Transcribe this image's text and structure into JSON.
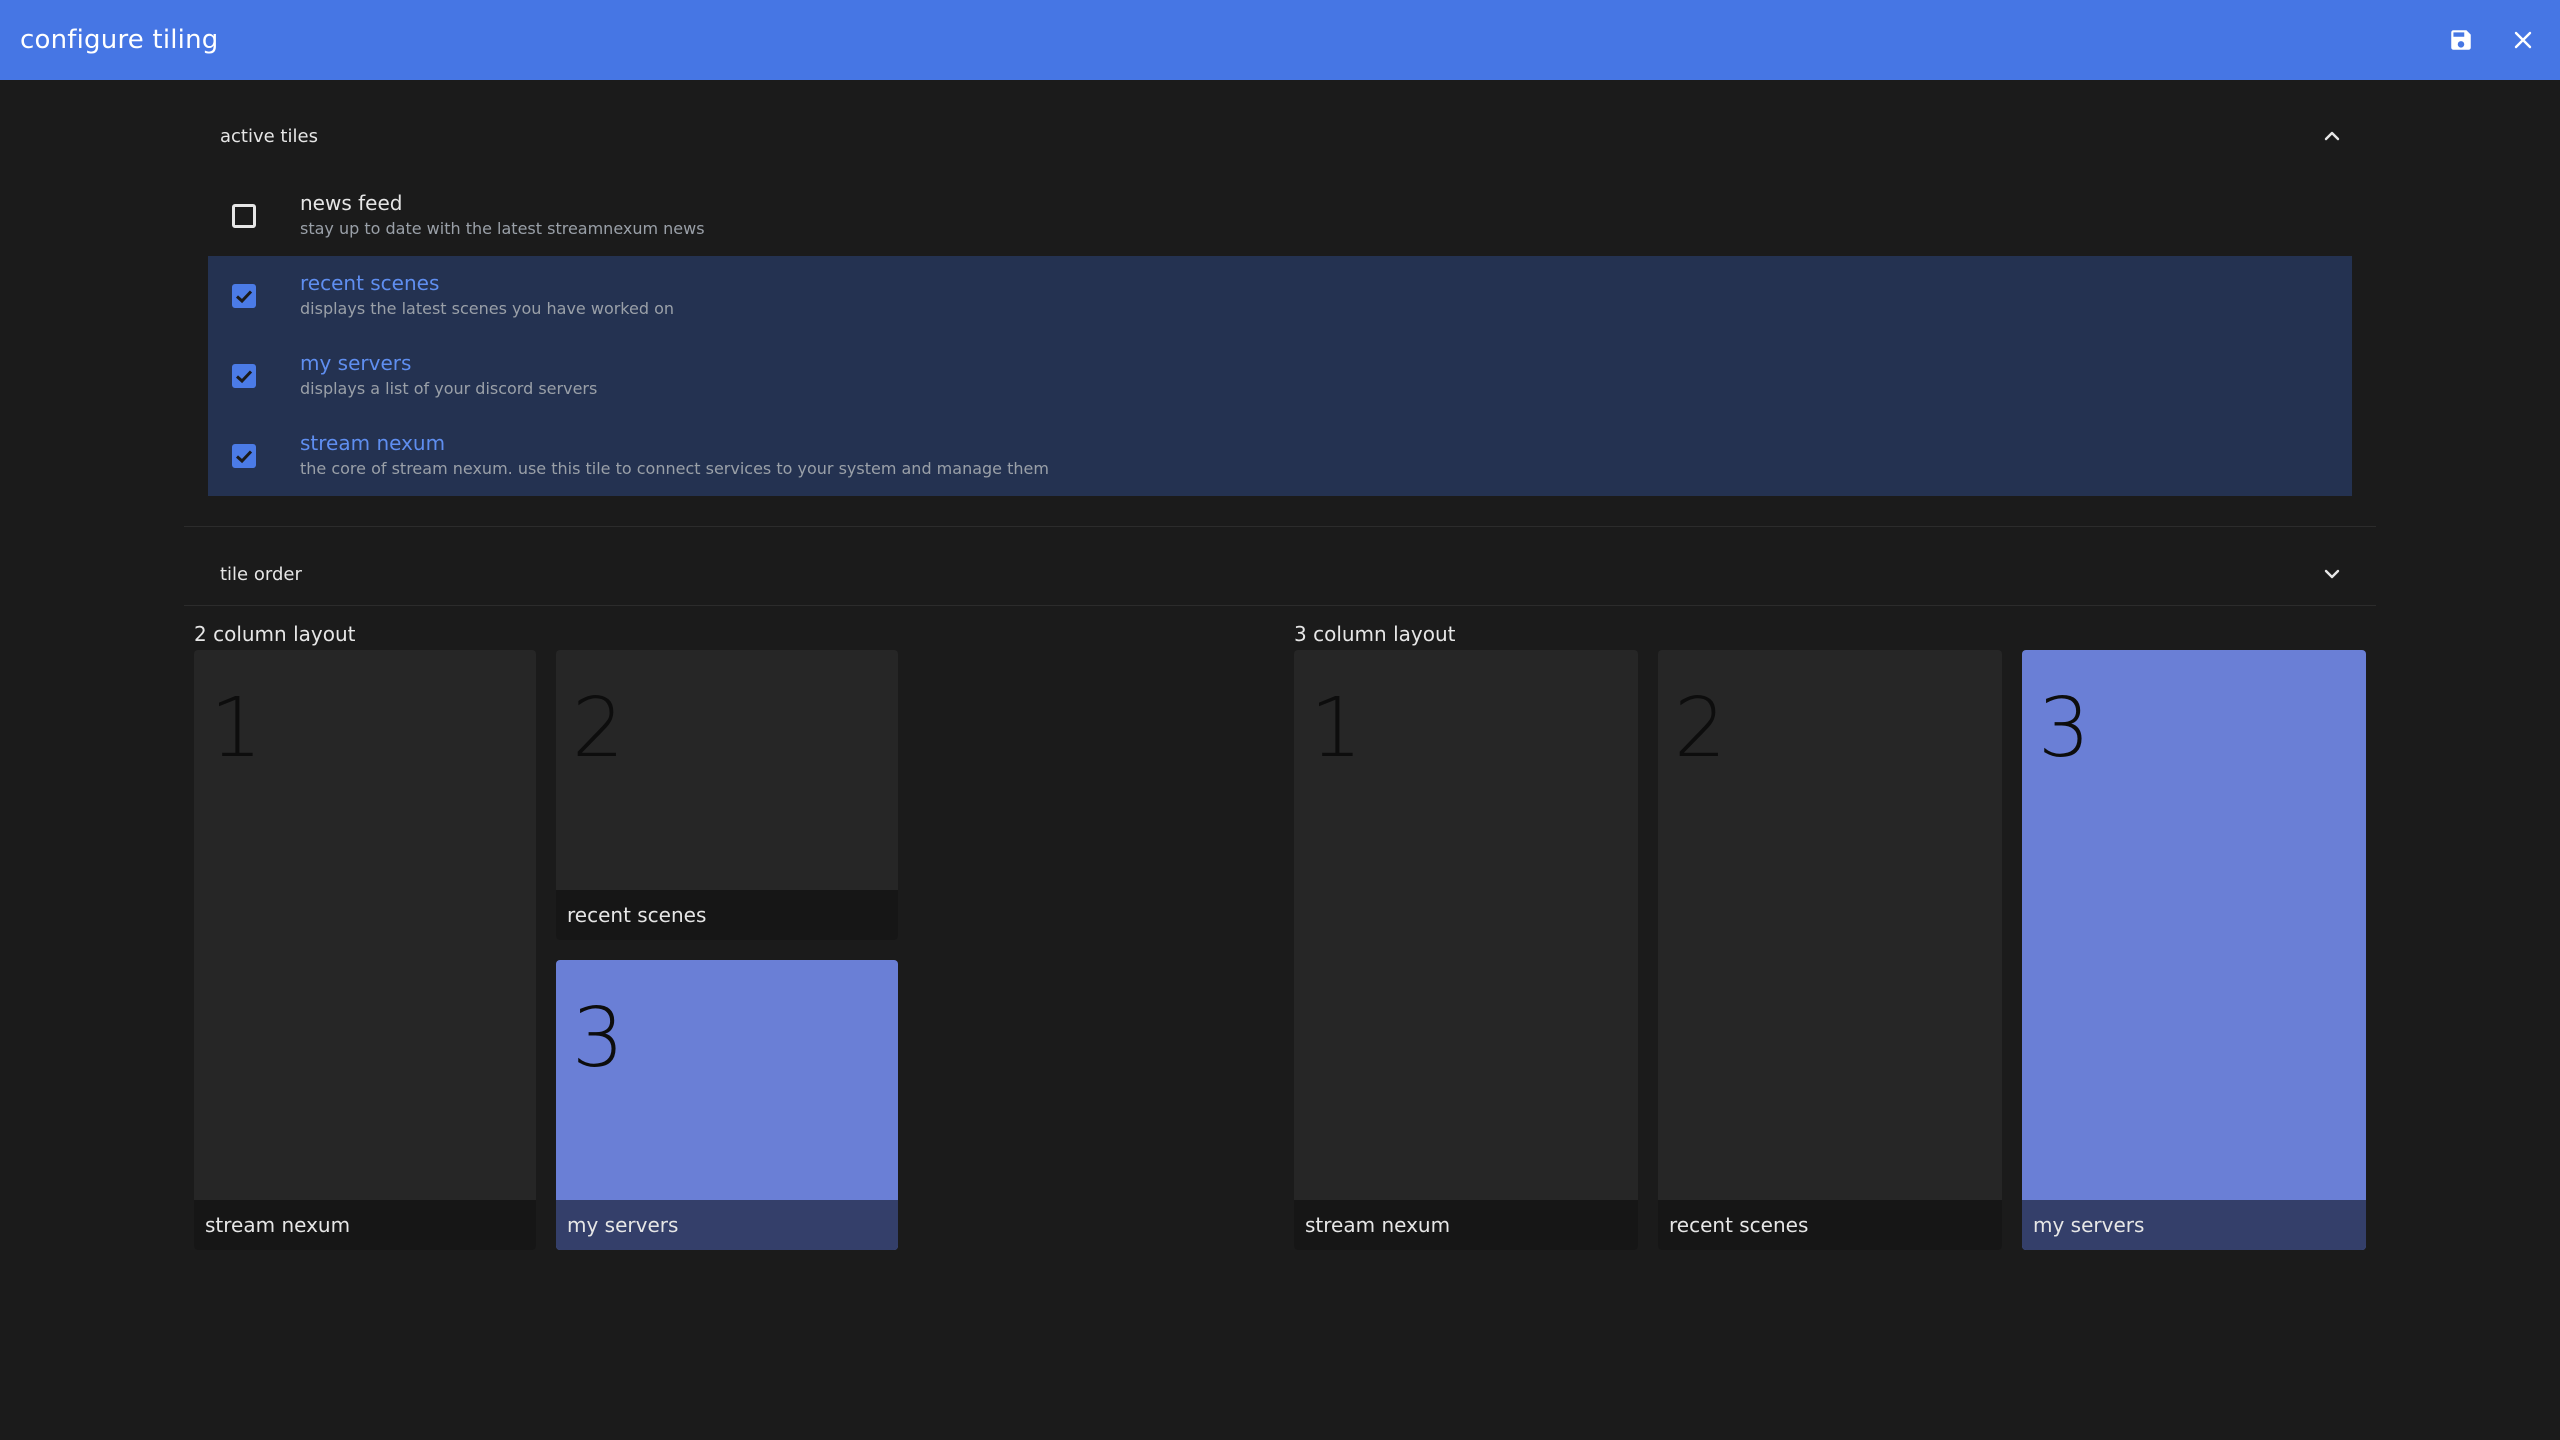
{
  "appbar": {
    "title": "configure tiling",
    "save_icon": "save-icon",
    "close_icon": "close-icon",
    "color": "#4676e4"
  },
  "active_tiles": {
    "header": "active tiles",
    "expanded": true,
    "items": [
      {
        "name": "news feed",
        "description": "stay up to date with the latest streamnexum news",
        "checked": false
      },
      {
        "name": "recent scenes",
        "description": "displays the latest scenes you have worked on",
        "checked": true
      },
      {
        "name": "my servers",
        "description": "displays a list of your discord servers",
        "checked": true
      },
      {
        "name": "stream nexum",
        "description": "the core of stream nexum. use this tile to connect services to your system and manage them",
        "checked": true
      }
    ]
  },
  "tile_order": {
    "header": "tile order",
    "expanded": false,
    "two_column": {
      "label": "2 column layout",
      "cards": [
        {
          "num": "1",
          "name": "stream nexum",
          "highlight": false
        },
        {
          "num": "2",
          "name": "recent scenes",
          "highlight": false
        },
        {
          "num": "3",
          "name": "my servers",
          "highlight": true
        }
      ]
    },
    "three_column": {
      "label": "3 column layout",
      "cards": [
        {
          "num": "1",
          "name": "stream nexum",
          "highlight": false
        },
        {
          "num": "2",
          "name": "recent scenes",
          "highlight": false
        },
        {
          "num": "3",
          "name": "my servers",
          "highlight": true
        }
      ]
    }
  },
  "colors": {
    "accent": "#4b7be6",
    "selected_row": "#243251",
    "highlight_card": "#6a7fd6"
  }
}
